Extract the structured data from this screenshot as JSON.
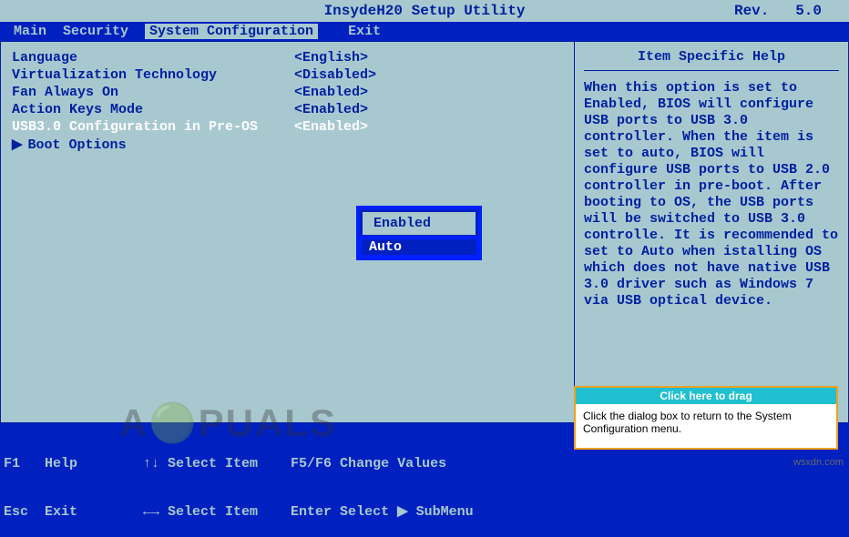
{
  "header": {
    "title": "InsydeH20 Setup Utility",
    "rev_label": "Rev.",
    "rev_value": "5.0"
  },
  "menubar": {
    "items": [
      "Main",
      "Security",
      "System Configuration",
      "Exit"
    ],
    "active_index": 2
  },
  "settings": [
    {
      "label": "Language",
      "value": "<English>",
      "selected": false
    },
    {
      "label": "Virtualization Technology",
      "value": "<Disabled>",
      "selected": false
    },
    {
      "label": "Fan Always On",
      "value": "<Enabled>",
      "selected": false
    },
    {
      "label": "Action Keys Mode",
      "value": "<Enabled>",
      "selected": false
    },
    {
      "label": "USB3.0 Configuration in Pre-OS",
      "value": "<Enabled>",
      "selected": true
    }
  ],
  "submenu": {
    "arrow": "▶",
    "label": "Boot Options"
  },
  "popup": {
    "options": [
      "Enabled",
      "Auto"
    ],
    "selected_index": 0
  },
  "help": {
    "title": "Item Specific Help",
    "body": "When this option is set to Enabled, BIOS will configure USB ports to USB 3.0 controller. When the item is set to auto, BIOS will configure USB ports to USB 2.0 controller in pre-boot. After booting to OS, the USB ports will be switched to USB 3.0 controlle. It is recommended to set to Auto when istalling OS which does not have native USB 3.0 driver such as Windows 7 via USB optical device."
  },
  "footer": {
    "line1": "F1   Help        ↑↓ Select Item    F5/F6 Change Values       ",
    "line2": "Esc  Exit        ←→ Select Item    Enter Select ▶ SubMenu    "
  },
  "watermark": "A🟢PUALS",
  "watermark_url": "wsxdn.com",
  "drag_overlay": {
    "header": "Click here to drag",
    "body": "Click the dialog box to return to the System Configuration menu."
  }
}
